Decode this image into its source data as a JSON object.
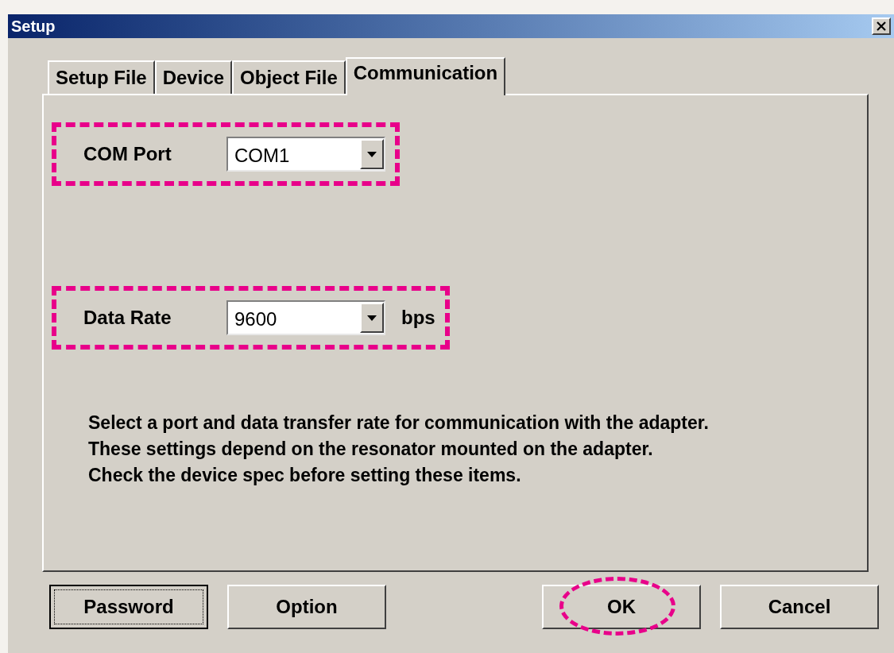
{
  "window": {
    "title": "Setup"
  },
  "tabs": [
    {
      "label": "Setup File",
      "selected": false
    },
    {
      "label": "Device",
      "selected": false
    },
    {
      "label": "Object File",
      "selected": false
    },
    {
      "label": "Communication",
      "selected": true
    }
  ],
  "fields": [
    {
      "label": "COM Port",
      "value": "COM1",
      "highlighted": true
    },
    {
      "label": "Data Rate",
      "value": "9600",
      "unit": "bps",
      "highlighted": true
    }
  ],
  "notes": [
    "Select a port and data transfer rate for communication with the adapter.",
    "These settings depend on the resonator mounted on the adapter.",
    "Check the device spec before setting these items."
  ],
  "buttons": [
    {
      "label": "Password",
      "focused": true,
      "highlighted": false
    },
    {
      "label": "Option",
      "focused": false,
      "highlighted": false
    },
    {
      "label": "OK",
      "focused": false,
      "highlighted": true
    },
    {
      "label": "Cancel",
      "focused": false,
      "highlighted": false
    }
  ]
}
